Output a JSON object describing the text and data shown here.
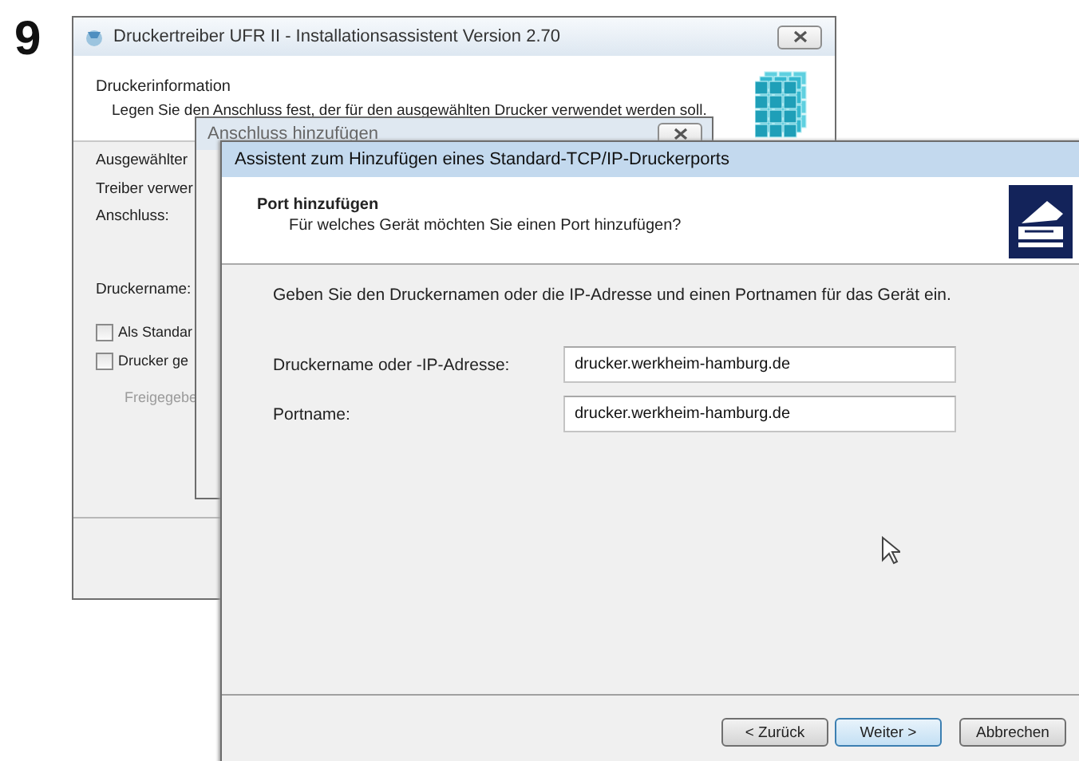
{
  "step": "9",
  "installer": {
    "title": "Druckertreiber UFR II - Installationsassistent Version 2.70",
    "heading": "Druckerinformation",
    "description": "Legen Sie den Anschluss fest, der für den ausgewählten Drucker verwendet werden soll.",
    "labels": [
      "Ausgewählter",
      "Treiber verwer",
      "Anschluss:",
      "Druckername:"
    ],
    "checkboxes": [
      {
        "label": "Als Standar",
        "checked": false
      },
      {
        "label": "Drucker ge",
        "checked": false
      }
    ],
    "disabled_label": "Freigegebe"
  },
  "port_dialog": {
    "title": "Anschluss hinzufügen"
  },
  "wizard": {
    "title": "Assistent zum Hinzufügen eines Standard-TCP/IP-Druckerports",
    "heading": "Port hinzufügen",
    "subtitle": "Für welches Gerät möchten Sie einen Port hinzufügen?",
    "instruction": "Geben Sie den Druckernamen oder die IP-Adresse und einen Portnamen für das Gerät ein.",
    "fields": [
      {
        "label": "Druckername oder -IP-Adresse:",
        "value": "drucker.werkheim-hamburg.de"
      },
      {
        "label": "Portname:",
        "value": "drucker.werkheim-hamburg.de"
      }
    ],
    "buttons": [
      {
        "label": "< Zurück",
        "default": false
      },
      {
        "label": "Weiter >",
        "default": true
      },
      {
        "label": "Abbrechen",
        "default": false
      }
    ]
  }
}
